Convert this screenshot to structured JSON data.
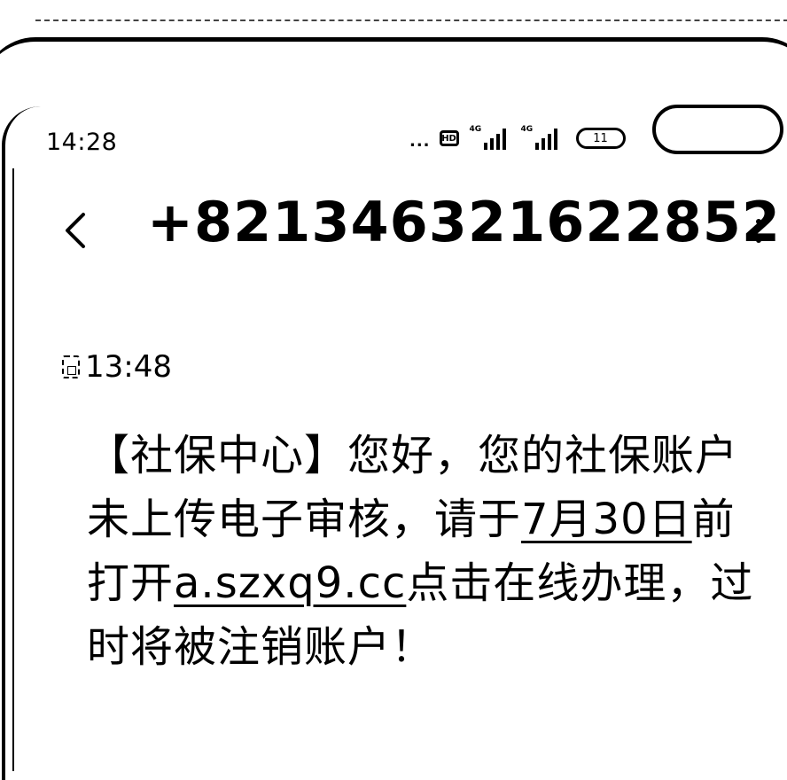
{
  "status_bar": {
    "time": "14:28",
    "dots": "...",
    "hd_label": "HD",
    "signal_1_tag": "4G",
    "signal_2_tag": "4G",
    "battery_level": "11"
  },
  "header": {
    "sender": "+821346321622852"
  },
  "message": {
    "time": "13:48",
    "part1": "【社保中心】您好，您的社保账户未上传电子审核，请于",
    "date": "7月30日",
    "part2": "前打开",
    "link": "a.szxq9.cc",
    "part3": "点击在线办理，过时将被注销账户！"
  },
  "icons": {
    "back": "chevron-left-icon",
    "more": "more-vertical-icon",
    "sim": "sim-card-icon",
    "hd": "hd-icon",
    "signal": "signal-icon",
    "battery": "battery-icon"
  }
}
